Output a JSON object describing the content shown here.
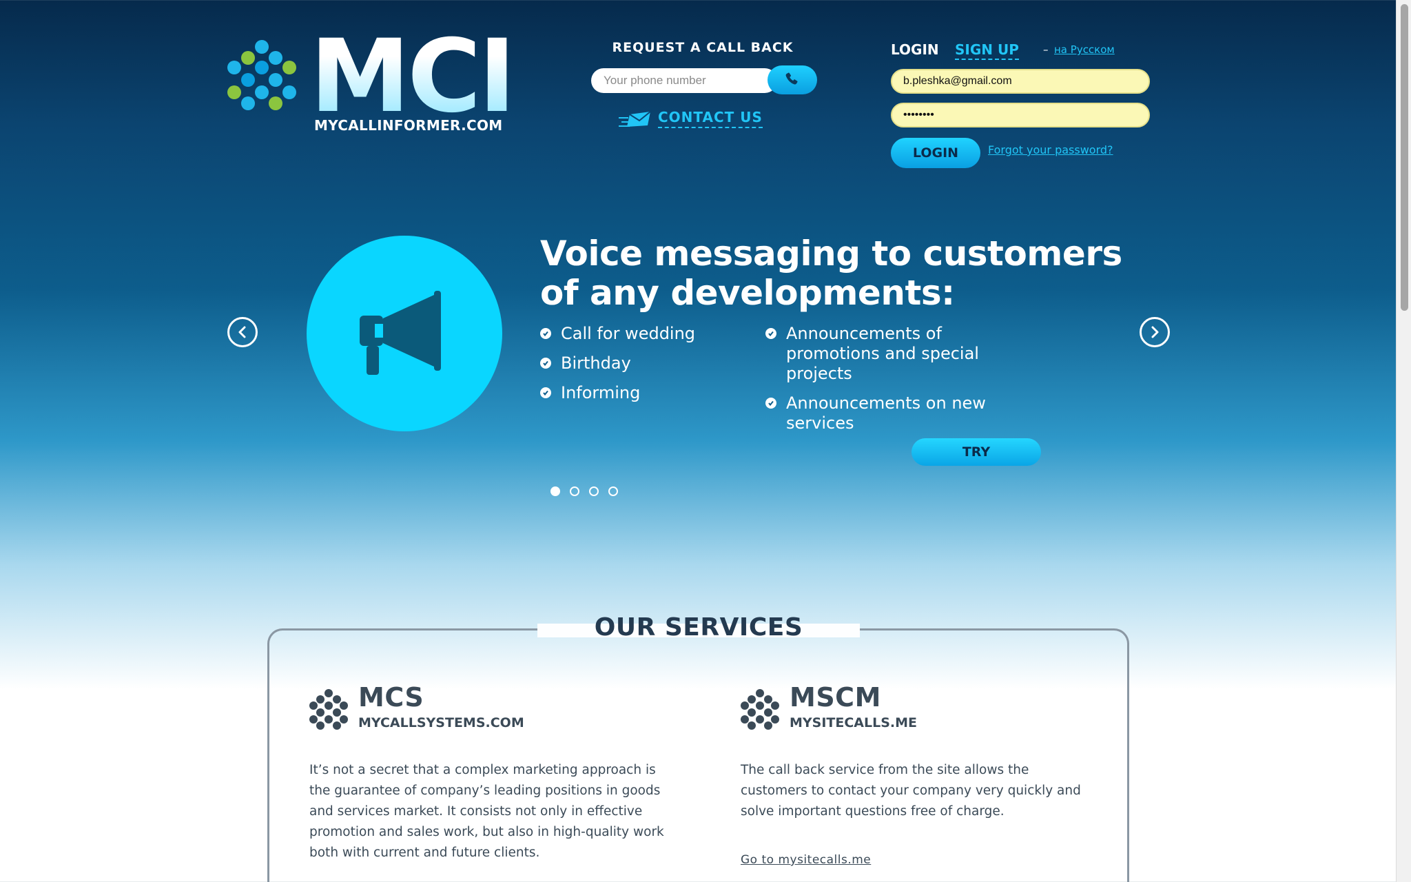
{
  "brand": {
    "logo_text": "MCI",
    "domain": "MYCALLINFORMER.COM",
    "dot_colors": [
      "#8bc53f",
      "#1fb5ea",
      "#0a9fe0"
    ]
  },
  "callback": {
    "title": "REQUEST A CALL BACK",
    "phone_placeholder": "Your phone number",
    "call_icon": "phone-icon",
    "contact_label": "CONTACT US",
    "contact_icon": "mail-flying-icon"
  },
  "auth": {
    "login_label": "LOGIN",
    "signup_label": "SIGN UP",
    "lang_dash": "–",
    "lang_label": "на Русском",
    "email_value": "b.pleshka@gmail.com",
    "password_value": "••••••••",
    "login_button": "LOGIN",
    "forgot_label": "Forgot your password?"
  },
  "slider": {
    "headline": "Voice messaging to customers of any developments:",
    "icon": "megaphone-icon",
    "left_bullets": [
      "Call for wedding",
      "Birthday",
      "Informing"
    ],
    "right_bullets": [
      "Announcements of promotions and special projects",
      "Announcements on new services"
    ],
    "try_button": "TRY",
    "slide_count": 4,
    "active_slide": 1,
    "prev_icon": "chevron-left-icon",
    "next_icon": "chevron-right-icon"
  },
  "services": {
    "title": "OUR SERVICES",
    "items": [
      {
        "name": "MCS",
        "domain": "MYCALLSYSTEMS.COM",
        "description": "It’s not a secret that a complex marketing approach is the guarantee of company’s leading positions in goods and services market. It consists not only in effective promotion and sales work, but also in high-quality work both with current and future clients.",
        "link": ""
      },
      {
        "name": "MSCM",
        "domain": "MYSITECALLS.ME",
        "description": "The call back service from the site allows the customers to contact your company very quickly and solve important questions free of charge.",
        "link": "Go to mysitecalls.me"
      }
    ]
  },
  "colors": {
    "accent": "#21c5f6",
    "field_bg": "#fbf8b6",
    "dark_text": "#3b4a57"
  }
}
